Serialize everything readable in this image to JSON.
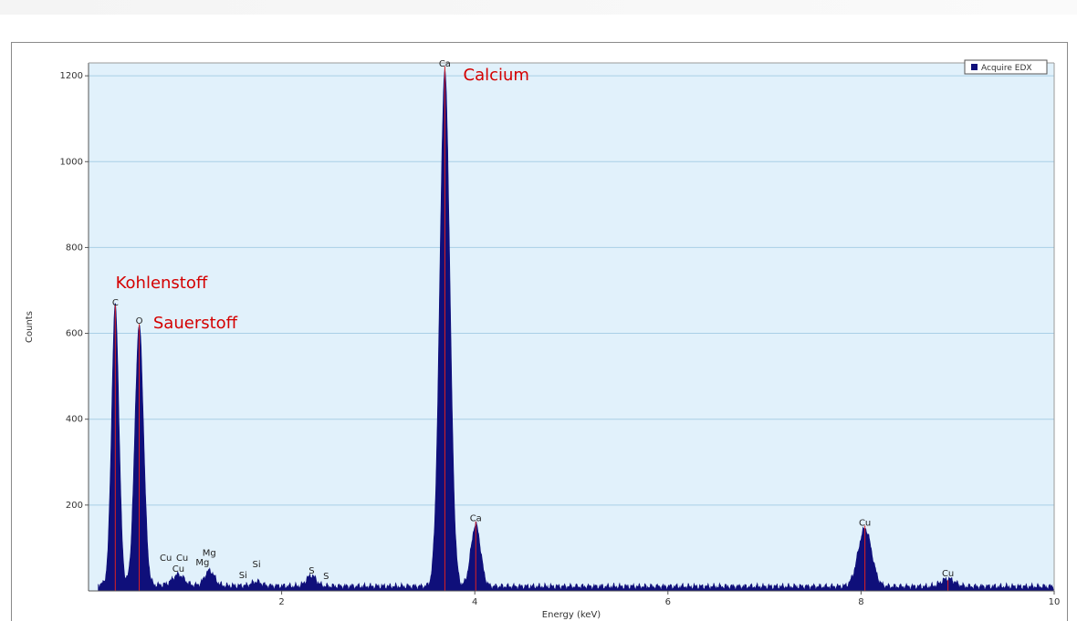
{
  "colors": {
    "plot_background": "#e1f1fb",
    "spectrum_fill": "#0f0f7a",
    "marker_line": "#e02020",
    "annotation_text": "#d40000",
    "grid": "#a9cfe6"
  },
  "chart_data": {
    "type": "area",
    "xlabel": "Energy (keV)",
    "ylabel": "Counts",
    "xlim": [
      0,
      10
    ],
    "ylim": [
      0,
      1230
    ],
    "x_ticks": [
      2,
      4,
      6,
      8,
      10
    ],
    "y_ticks": [
      200,
      400,
      600,
      800,
      1000,
      1200
    ],
    "grid": "horizontal",
    "legend": {
      "position": "top-right",
      "entries": [
        "Acquire EDX"
      ]
    },
    "series": [
      {
        "name": "Acquire EDX",
        "color": "#0f0f7a"
      }
    ],
    "baseline_counts": 10,
    "peaks": [
      {
        "element": "C",
        "energy": 0.277,
        "counts": 650,
        "width": 0.038
      },
      {
        "element": "O",
        "energy": 0.525,
        "counts": 605,
        "width": 0.045
      },
      {
        "element": "Cu",
        "energy": 0.93,
        "counts": 25,
        "width": 0.06
      },
      {
        "element": "Mg",
        "energy": 1.254,
        "counts": 35,
        "width": 0.05
      },
      {
        "element": "Si",
        "energy": 1.74,
        "counts": 10,
        "width": 0.05
      },
      {
        "element": "S",
        "energy": 2.307,
        "counts": 25,
        "width": 0.05
      },
      {
        "element": "Ca",
        "energy": 3.69,
        "counts": 1200,
        "width": 0.052
      },
      {
        "element": "Ca",
        "energy": 4.01,
        "counts": 145,
        "width": 0.05
      },
      {
        "element": "Cu",
        "energy": 8.04,
        "counts": 135,
        "width": 0.07
      },
      {
        "element": "Cu",
        "energy": 8.9,
        "counts": 18,
        "width": 0.07
      }
    ],
    "peak_labels": [
      {
        "text": "C",
        "energy": 0.277,
        "counts": 665
      },
      {
        "text": "O",
        "energy": 0.525,
        "counts": 622
      },
      {
        "text": "Cu",
        "energy": 0.8,
        "counts": 70
      },
      {
        "text": "Cu",
        "energy": 0.93,
        "counts": 45
      },
      {
        "text": "Cu",
        "energy": 0.97,
        "counts": 70
      },
      {
        "text": "Mg",
        "energy": 1.18,
        "counts": 60
      },
      {
        "text": "Mg",
        "energy": 1.25,
        "counts": 82
      },
      {
        "text": "Si",
        "energy": 1.6,
        "counts": 30
      },
      {
        "text": "Si",
        "energy": 1.74,
        "counts": 55
      },
      {
        "text": "S",
        "energy": 2.31,
        "counts": 40
      },
      {
        "text": "S",
        "energy": 2.46,
        "counts": 28
      },
      {
        "text": "Ca",
        "energy": 3.69,
        "counts": 1222
      },
      {
        "text": "Ca",
        "energy": 4.01,
        "counts": 162
      },
      {
        "text": "Cu",
        "energy": 8.04,
        "counts": 152
      },
      {
        "text": "Cu",
        "energy": 8.9,
        "counts": 34
      }
    ],
    "markers": [
      {
        "energy": 0.277,
        "top_counts": 665
      },
      {
        "energy": 0.525,
        "top_counts": 622
      },
      {
        "energy": 3.69,
        "top_counts": 1222
      },
      {
        "energy": 4.01,
        "top_counts": 162
      },
      {
        "energy": 8.04,
        "top_counts": 152
      },
      {
        "energy": 8.9,
        "top_counts": 25
      }
    ],
    "annotations": [
      {
        "text": "Kohlenstoff",
        "energy": 0.28,
        "counts": 705
      },
      {
        "text": "Sauerstoff",
        "energy": 0.67,
        "counts": 612
      },
      {
        "text": "Calcium",
        "energy": 3.88,
        "counts": 1190
      }
    ]
  }
}
